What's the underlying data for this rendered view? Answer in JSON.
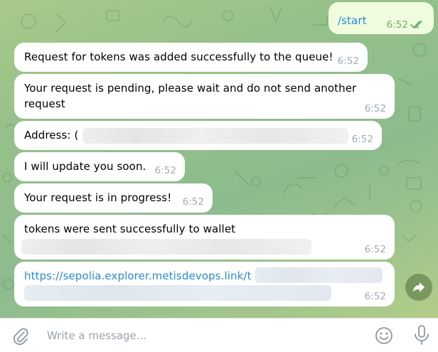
{
  "chat": {
    "outgoing": {
      "text": "/start",
      "time": "6:52",
      "read_status": "double-check-icon"
    },
    "messages": [
      {
        "text": "Request for tokens was added successfully to the queue!",
        "time": "6:52"
      },
      {
        "line1": "Your request is pending, please wait and do not send another",
        "line2": "request",
        "time": "6:52"
      },
      {
        "text": "Address: (",
        "time": "6:52"
      },
      {
        "text": "I will update you soon.",
        "time": "6:52"
      },
      {
        "text": "Your request is in progress!",
        "time": "6:52"
      },
      {
        "text": "tokens were sent successfully to wallet",
        "time": "6:52"
      },
      {
        "text": "https://sepolia.explorer.metisdevops.link/t",
        "time": "6:52"
      }
    ]
  },
  "composer": {
    "placeholder": "Write a message..."
  },
  "colors": {
    "outgoing_bubble": "#effdde",
    "incoming_bubble": "#ffffff",
    "link": "#2a8bd0",
    "read_check": "#6eaf66"
  }
}
